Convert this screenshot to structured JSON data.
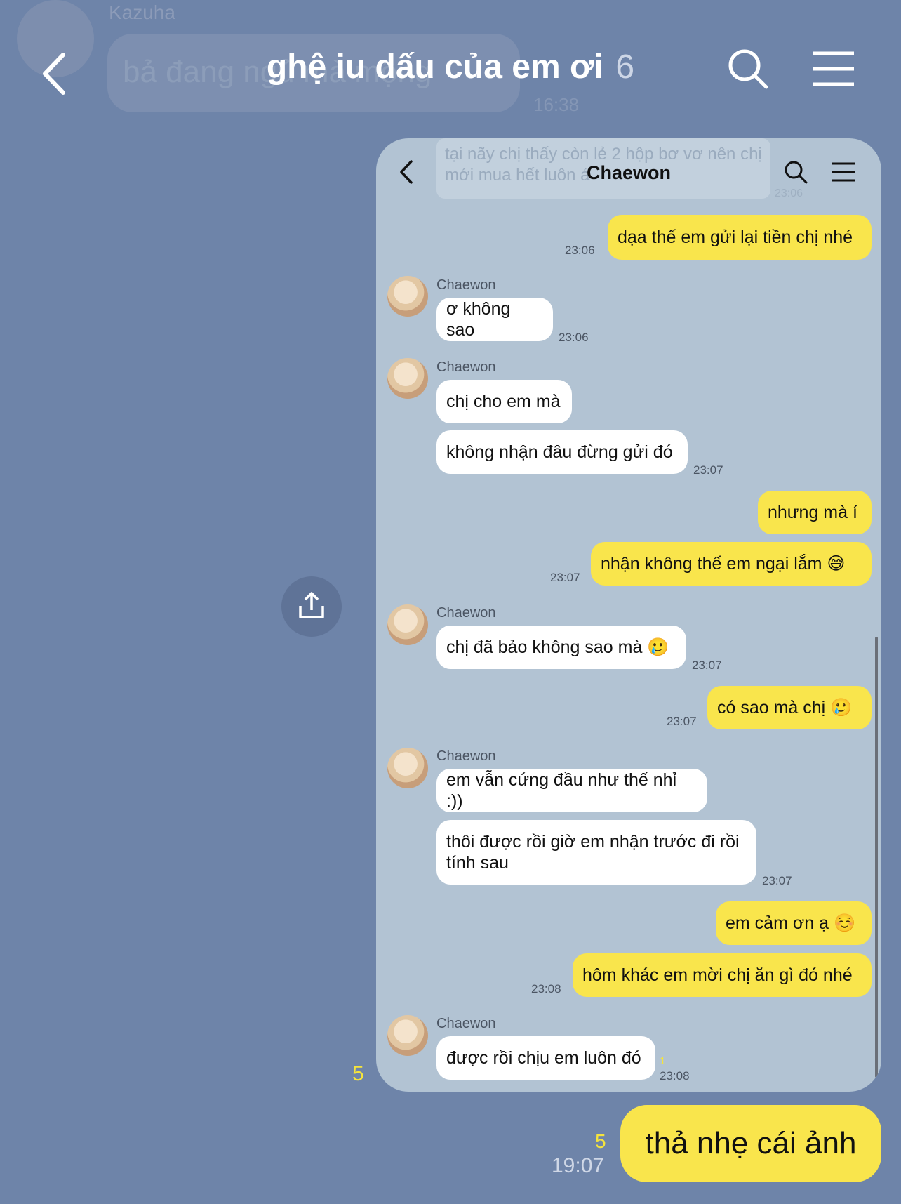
{
  "previous": {
    "sender": "Kazuha",
    "text": "bả đang ngủ mà mộng",
    "time": "16:38"
  },
  "header": {
    "title": "ghệ iu dấu của em ơi",
    "member_count": "6"
  },
  "shared_image_unread": "5",
  "screenshot": {
    "title": "Chaewon",
    "prev_text": "tại nãy chị thấy còn lẻ 2 hộp bơ vơ nên chị mới mua hết luôn á",
    "prev_time": "23:06",
    "messages": [
      {
        "text": "dạa thế em gửi lại tiền chị nhé",
        "time": "23:06"
      },
      {
        "name": "Chaewon",
        "text": "ơ không sao",
        "time": "23:06"
      },
      {
        "name": "Chaewon",
        "text": "chị cho em mà"
      },
      {
        "text": "không nhận đâu đừng gửi đó",
        "time": "23:07"
      },
      {
        "text": "nhưng mà í"
      },
      {
        "text": "nhận không thế em ngại lắm 😅",
        "time": "23:07"
      },
      {
        "name": "Chaewon",
        "text": "chị đã bảo không sao mà 🥲",
        "time": "23:07"
      },
      {
        "text": "có sao mà chị 🥲",
        "time": "23:07"
      },
      {
        "name": "Chaewon",
        "text": "em vẫn cứng đầu như thế nhỉ :))"
      },
      {
        "text": "thôi được rồi giờ em nhận trước đi rồi tính sau",
        "time": "23:07"
      },
      {
        "text": "em cảm ơn ạ ☺️"
      },
      {
        "text": "hôm khác em mời chị ăn gì đó nhé",
        "time": "23:08"
      },
      {
        "name": "Chaewon",
        "text": "được rồi chịu em luôn đó",
        "time": "23:08",
        "unread": "1"
      }
    ]
  },
  "my_message": {
    "text": "thả nhẹ cái ảnh",
    "unread": "5",
    "time": "19:07"
  }
}
